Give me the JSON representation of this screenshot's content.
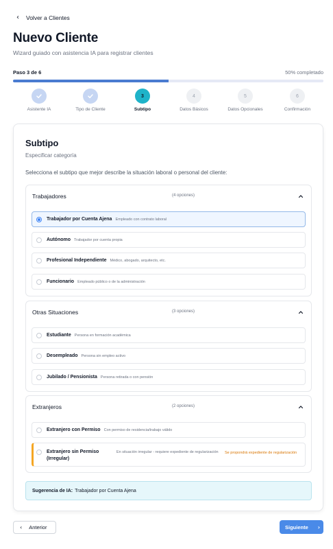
{
  "nav": {
    "back_label": "Volver a Clientes"
  },
  "header": {
    "title": "Nuevo Cliente",
    "subtitle": "Wizard guiado con asistencia IA para registrar clientes"
  },
  "progress": {
    "step_text": "Paso 3 de 6",
    "percent_text": "50% completado",
    "fraction": 0.5
  },
  "steps": [
    {
      "label": "Asistente IA",
      "status": "done",
      "number": "1"
    },
    {
      "label": "Tipo de Cliente",
      "status": "done",
      "number": "2"
    },
    {
      "label": "Subtipo",
      "status": "current",
      "number": "3"
    },
    {
      "label": "Datos Básicos",
      "status": "pending",
      "number": "4"
    },
    {
      "label": "Datos Opcionales",
      "status": "pending",
      "number": "5"
    },
    {
      "label": "Confirmación",
      "status": "pending",
      "number": "6"
    }
  ],
  "card": {
    "title": "Subtipo",
    "subtitle": "Especificar categoría",
    "description": "Selecciona el subtipo que mejor describe la situación laboral o personal del cliente:"
  },
  "groups": [
    {
      "title": "Trabajadores",
      "count": "(4 opciones)",
      "options": [
        {
          "label": "Trabajador por Cuenta Ajena",
          "desc": "Empleado con contrato laboral",
          "selected": true
        },
        {
          "label": "Autónomo",
          "desc": "Trabajador por cuenta propia"
        },
        {
          "label": "Profesional Independiente",
          "desc": "Médico, abogado, arquitecto, etc."
        },
        {
          "label": "Funcionario",
          "desc": "Empleado público o de la administración"
        }
      ]
    },
    {
      "title": "Otras Situaciones",
      "count": "(3 opciones)",
      "options": [
        {
          "label": "Estudiante",
          "desc": "Persona en formación académica"
        },
        {
          "label": "Desempleado",
          "desc": "Persona sin empleo activo"
        },
        {
          "label": "Jubilado / Pensionista",
          "desc": "Persona retirada o con pensión"
        }
      ]
    },
    {
      "title": "Extranjeros",
      "count": "(2 opciones)",
      "options": [
        {
          "label": "Extranjero con Permiso",
          "desc": "Con permiso de residencia/trabajo válido"
        },
        {
          "label": "Extranjero sin Permiso (Irregular)",
          "desc": "En situación irregular - requiere expediente de regularización",
          "warning": "Se propondrá expediente de regularización"
        }
      ]
    }
  ],
  "suggestion": {
    "label": "Sugerencia de IA:",
    "value": "Trabajador por Cuenta Ajena"
  },
  "footer": {
    "prev_label": "Anterior",
    "next_label": "Siguiente"
  },
  "colors": {
    "accent": "#4a8ae8",
    "progress": "#4a7bd0",
    "current_step": "#1fb3c9",
    "warning": "#f5a623"
  },
  "icons": {
    "back": "chevron-left-icon",
    "done_step": "check-icon",
    "group_toggle": "chevron-up-icon",
    "next": "chevron-right-icon"
  }
}
